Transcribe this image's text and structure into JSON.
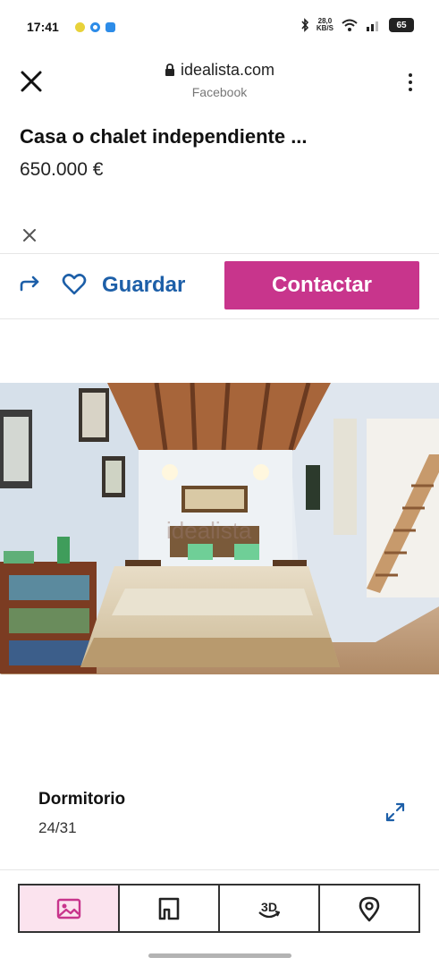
{
  "status_bar": {
    "time": "17:41",
    "data_rate_top": "28,0",
    "data_rate_bottom": "KB/S",
    "battery": "65"
  },
  "browser": {
    "domain": "idealista.com",
    "source": "Facebook",
    "icons": [
      "close-icon",
      "lock-icon",
      "more-vert-icon"
    ]
  },
  "listing": {
    "title": "Casa o chalet independiente ...",
    "price": "650.000 €"
  },
  "actions": {
    "save_label": "Guardar",
    "contact_label": "Contactar",
    "icons": [
      "share-icon",
      "heart-icon"
    ]
  },
  "photo": {
    "watermark": "idealista",
    "caption": "Dormitorio",
    "counter": "24/31",
    "icons": [
      "expand-icon"
    ]
  },
  "tabs": {
    "items": [
      "photos-tab",
      "floorplan-tab",
      "3d-tour-tab",
      "map-tab"
    ],
    "active": "photos-tab"
  },
  "colors": {
    "brand_magenta": "#c8358c",
    "link_blue": "#1d5fa8",
    "active_tab_bg": "#fbe3ee"
  }
}
